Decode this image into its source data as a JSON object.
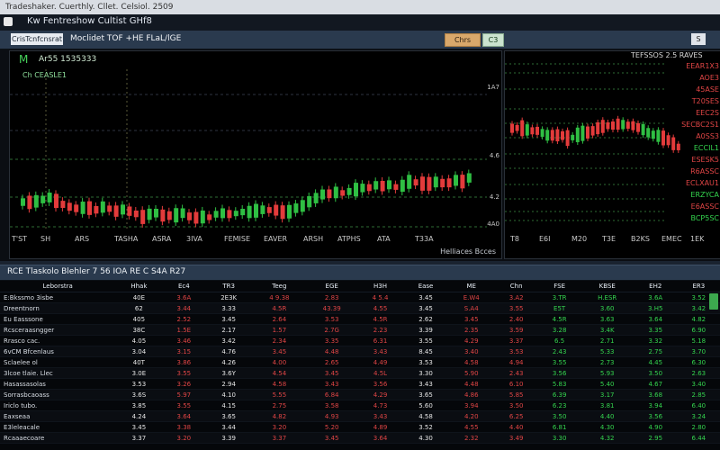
{
  "titlebar": {
    "title": "Tradeshaker. Cuerthly. Cllet. Celsiol. 2509"
  },
  "window": {
    "app_title": "Kw Fentreshow Cultist GHf8"
  },
  "toolbar": {
    "left_button": "CrisTcnfcnsrat",
    "market_text": "Moclidet TOF +HE FLaL/lGE",
    "btn_1": "Chrs",
    "btn_2": "C3",
    "btn_3": "S"
  },
  "chart_left": {
    "symbol": "M",
    "symbol_text": "Ar55 1535333",
    "ohlc": "Ch CEASLE1",
    "price_labels": [
      "1A7",
      "4.6",
      "4.2",
      "4A0"
    ],
    "time_labels": [
      "T'ST",
      "SH",
      "ARS",
      "TASHA",
      "ASRA",
      "3IVA",
      "FEMISE",
      "EAVER",
      "ARSH",
      "ATPHS",
      "ATA",
      "T33A"
    ],
    "footer": "Helliaces Bcces"
  },
  "chart_right": {
    "title": "TEFSSOS 2.5 RAVES",
    "levels": [
      {
        "label": "EEAR1X3",
        "color": "r"
      },
      {
        "label": "AOE3",
        "color": "r"
      },
      {
        "label": "45ASE",
        "color": "r"
      },
      {
        "label": "T20SES",
        "color": "r"
      },
      {
        "label": "EEC2S",
        "color": "r"
      },
      {
        "label": "SECBC2S1",
        "color": "r"
      },
      {
        "label": "A0SS3",
        "color": "r"
      },
      {
        "label": "ECCIL1",
        "color": "g"
      },
      {
        "label": "ESESK5",
        "color": "r"
      },
      {
        "label": "R6ASSC",
        "color": "r"
      },
      {
        "label": "ECLXAU1",
        "color": "r"
      },
      {
        "label": "ERZYCA",
        "color": "g"
      },
      {
        "label": "E6ASSC",
        "color": "r"
      },
      {
        "label": "BCP5SC",
        "color": "g"
      }
    ],
    "time_labels": [
      "T8",
      "E6I",
      "M20",
      "T3E",
      "B2KS",
      "EMEC",
      "1EK"
    ]
  },
  "table": {
    "title": "RCE Tlaskolo Blehler   7  56 IOA RE   C S4A  R27",
    "headers": [
      "Leborstra",
      "Hhak",
      "Ec4",
      "TR3",
      "Teeg",
      "EGE",
      "H3H",
      "Ease",
      "ME",
      "Chn",
      "FSE",
      "KBSE",
      "EH2",
      "ER3"
    ],
    "rows": [
      [
        "E:Bkssmo 3isbe",
        "40E",
        "3.6A",
        "2E3K",
        "4 9.38",
        "2.83",
        "4 5.4",
        "3.45",
        "E.W4",
        "3.A2",
        "3.TR",
        "H.ESR",
        "3.6A",
        "3.52"
      ],
      [
        "Dreentnorn",
        "62",
        "3.44",
        "3.33",
        "4.5R",
        "43.39",
        "4.55",
        "3.45",
        "S.A4",
        "3.55",
        "E5T",
        "3.60",
        "3.H5",
        "3.42"
      ],
      [
        "Eu Easssone",
        "405",
        "2.52",
        "3.45",
        "2.64",
        "3.53",
        "4.5R",
        "2.62",
        "3.45",
        "2.40",
        "4.5R",
        "3.63",
        "3.64",
        "4.82"
      ],
      [
        "Rcsceraasngger",
        "38C",
        "1.5E",
        "2.17",
        "1.57",
        "2.7G",
        "2.23",
        "3.39",
        "2.35",
        "3.59",
        "3.28",
        "3.4K",
        "3.35",
        "6.90"
      ],
      [
        "Rrasco cac.",
        "4.05",
        "3.46",
        "3.42",
        "2.34",
        "3.35",
        "6.31",
        "3.55",
        "4.29",
        "3.37",
        "6.5",
        "2.71",
        "3.32",
        "5.18"
      ],
      [
        "6vCM Bfcenlaus",
        "3.04",
        "3.15",
        "4.76",
        "3.45",
        "4.48",
        "3.43",
        "8.45",
        "3.40",
        "3.53",
        "2.43",
        "5.33",
        "2.75",
        "3.70"
      ],
      [
        "Sclaelee ol",
        "40T",
        "3.86",
        "4.26",
        "4.00",
        "2.65",
        "4.49",
        "3.53",
        "4.58",
        "4.94",
        "3.55",
        "2.73",
        "4.45",
        "6.30"
      ],
      [
        "3lcoe tlaie. Llec",
        "3.0E",
        "3.55",
        "3.6Y",
        "4.54",
        "3.45",
        "4.5L",
        "3.30",
        "5.90",
        "2.43",
        "3.56",
        "5.93",
        "3.50",
        "2.63"
      ],
      [
        "Hasassasolas",
        "3.53",
        "3.26",
        "2.94",
        "4.58",
        "3.43",
        "3.56",
        "3.43",
        "4.48",
        "6.10",
        "5.83",
        "5.40",
        "4.67",
        "3.40"
      ],
      [
        "Sorrasbcaoass",
        "3.6S",
        "5.97",
        "4.10",
        "5.55",
        "6.84",
        "4.29",
        "3.65",
        "4.86",
        "5.85",
        "6.39",
        "3.17",
        "3.68",
        "2.85"
      ],
      [
        "Iriclo tubo.",
        "3.85",
        "3.55",
        "4.15",
        "2.75",
        "3.58",
        "4.73",
        "5.60",
        "3.94",
        "3.50",
        "6.23",
        "3.81",
        "3.94",
        "6.40"
      ],
      [
        "Eaxseaa",
        "4.24",
        "3.64",
        "3.65",
        "4.82",
        "4.93",
        "3.43",
        "4.58",
        "4.20",
        "6.25",
        "3.50",
        "4.40",
        "3.56",
        "3.24"
      ],
      [
        "E3leleacale",
        "3.45",
        "3.38",
        "3.44",
        "3.20",
        "5.20",
        "4.89",
        "3.52",
        "4.55",
        "4.40",
        "6.81",
        "4.30",
        "4.90",
        "2.80"
      ],
      [
        "Rcaaaecoare",
        "3.37",
        "3.20",
        "3.39",
        "3.37",
        "3.45",
        "3.64",
        "4.30",
        "2.32",
        "3.49",
        "3.30",
        "4.32",
        "2.95",
        "6.44"
      ]
    ]
  },
  "colors": {
    "bull": "#2fbf43",
    "bear": "#e33b3b",
    "accent_bar": "#2a3a4e"
  }
}
